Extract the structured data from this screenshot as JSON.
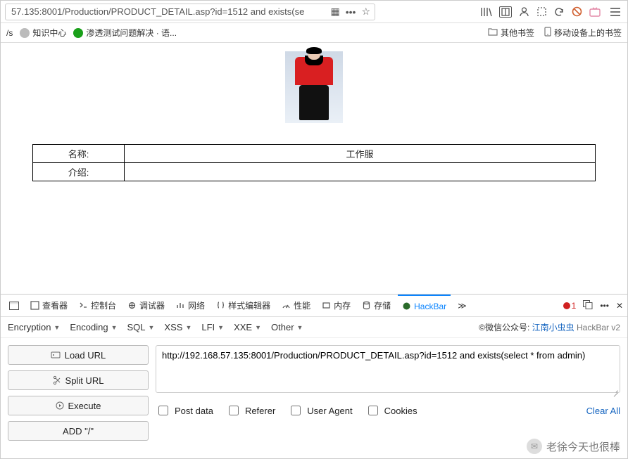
{
  "urlbar": {
    "value": "57.135:8001/Production/PRODUCT_DETAIL.asp?id=1512 and exists(se"
  },
  "bookmarks": {
    "left": [
      {
        "label": "/s"
      },
      {
        "label": "知识中心"
      },
      {
        "label": "渗透测试问题解决 · 语..."
      }
    ],
    "right": [
      {
        "label": "其他书签"
      },
      {
        "label": "移动设备上的书签"
      }
    ]
  },
  "product": {
    "name_label": "名称:",
    "name_value": "工作服",
    "desc_label": "介绍:",
    "desc_value": ""
  },
  "devtools": {
    "tabs": [
      {
        "label": "查看器"
      },
      {
        "label": "控制台"
      },
      {
        "label": "调试器"
      },
      {
        "label": "网络"
      },
      {
        "label": "样式编辑器"
      },
      {
        "label": "性能"
      },
      {
        "label": "内存"
      },
      {
        "label": "存储"
      },
      {
        "label": "HackBar"
      }
    ],
    "error_count": "1"
  },
  "hackbar": {
    "dropdowns": [
      "Encryption",
      "Encoding",
      "SQL",
      "XSS",
      "LFI",
      "XXE",
      "Other"
    ],
    "credit_prefix": "©微信公众号: ",
    "credit_link": "江南小虫虫",
    "credit_suffix": " HackBar v2",
    "buttons": {
      "load": "Load URL",
      "split": "Split URL",
      "execute": "Execute",
      "add": "ADD \"/\""
    },
    "textarea_value": "http://192.168.57.135:8001/Production/PRODUCT_DETAIL.asp?id=1512 and exists(select * from admin)",
    "checks": {
      "post": "Post data",
      "referer": "Referer",
      "ua": "User Agent",
      "cookies": "Cookies"
    },
    "clear_all": "Clear All"
  },
  "watermark": {
    "text": "老徐今天也很棒"
  }
}
